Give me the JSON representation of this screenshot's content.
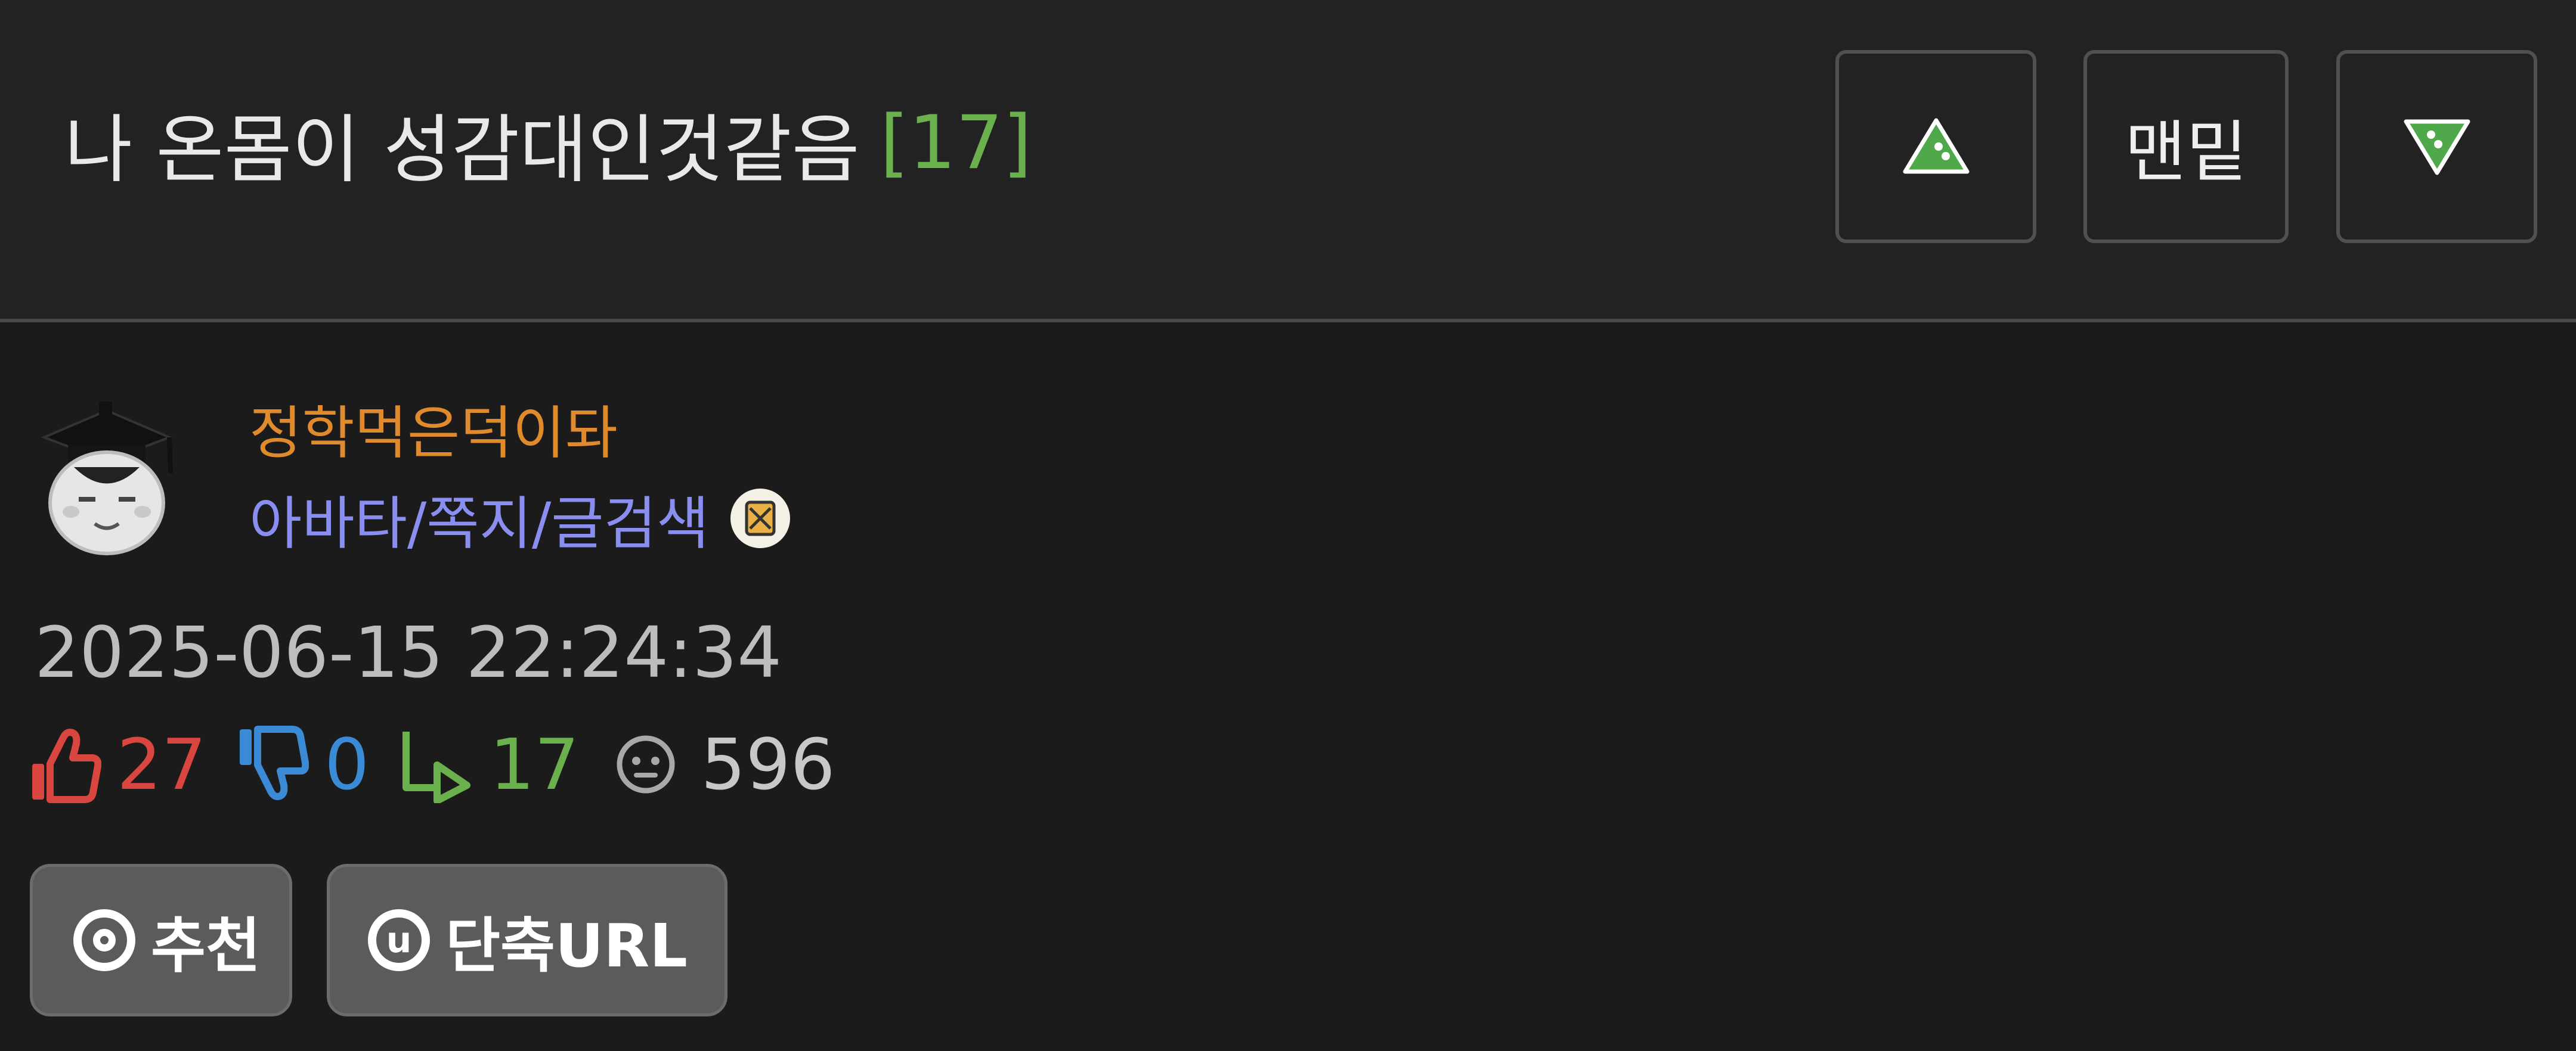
{
  "post": {
    "title": "나 온몸이 성감대인것같음",
    "comment_count": "[17]"
  },
  "nav": {
    "up_icon": "triangle-up-icon",
    "bottom_label": "맨밑",
    "down_icon": "triangle-down-icon"
  },
  "author": {
    "avatar_icon": "graduate-cap-avatar",
    "nickname": "정학먹은덕이돠",
    "links": "아바타/쪽지/글검색",
    "badge_icon": "level-badge-icon"
  },
  "meta": {
    "datetime": "2025-06-15 22:24:34"
  },
  "stats": {
    "upvotes": "27",
    "downvotes": "0",
    "replies": "17",
    "views": "596"
  },
  "actions": {
    "recommend_label": "추천",
    "short_url_label": "단축URL",
    "short_url_icon_letter": "u"
  },
  "colors": {
    "background": "#1b1b1b",
    "header_background": "#222222",
    "comment_count": "#6ab04c",
    "nickname": "#e08a2e",
    "links": "#8a8ef0",
    "upvote": "#d9453f",
    "downvote": "#3a8ad6",
    "reply": "#6ab04c",
    "button_bg": "#5b5b5b"
  }
}
